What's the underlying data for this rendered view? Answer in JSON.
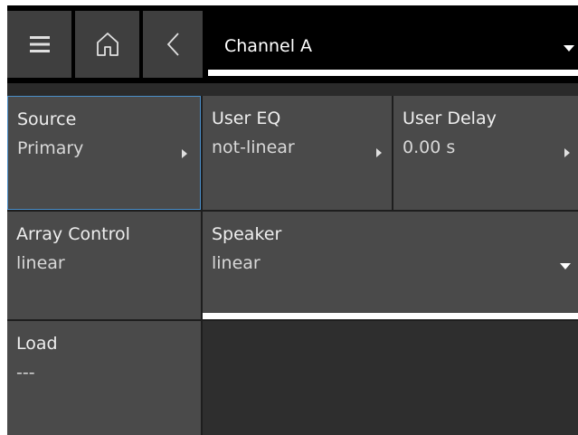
{
  "header": {
    "menu_icon": "hamburger-icon",
    "home_icon": "home-icon",
    "back_icon": "chevron-left-icon",
    "channel": "Channel A",
    "dropdown_icon": "caret-down-icon"
  },
  "cells": {
    "source": {
      "title": "Source",
      "value": "Primary"
    },
    "user_eq": {
      "title": "User EQ",
      "value": "not-linear"
    },
    "user_delay": {
      "title": "User Delay",
      "value": "0.00 s"
    },
    "array_control": {
      "title": "Array Control",
      "value": "linear"
    },
    "speaker": {
      "title": "Speaker",
      "value": "linear"
    },
    "load": {
      "title": "Load",
      "value": "---"
    }
  },
  "colors": {
    "background": "#1e1e1e",
    "cell": "#4a4a4a",
    "button": "#3f3f3f",
    "selected_border": "#4a8ec8",
    "text": "#eeeeee"
  }
}
